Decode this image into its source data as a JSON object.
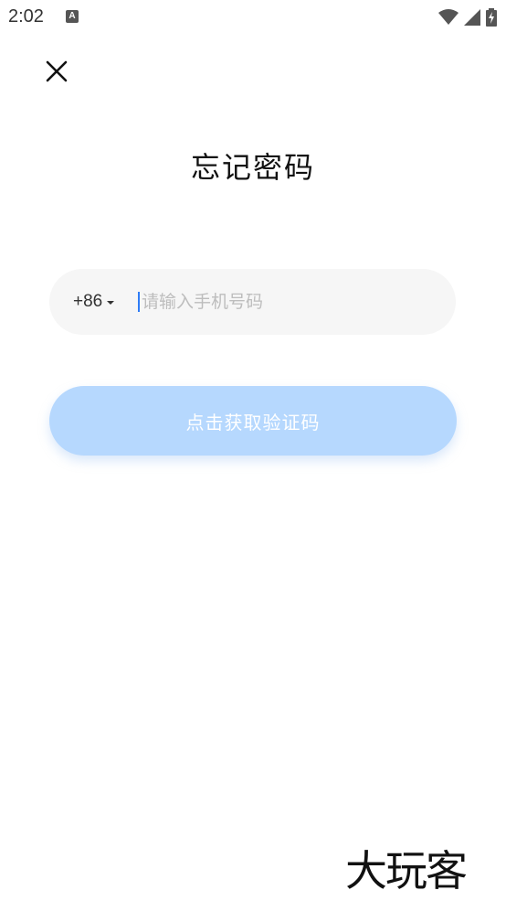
{
  "status_bar": {
    "time": "2:02",
    "notification_icon_letter": "A",
    "icons": [
      "wifi-icon",
      "signal-icon",
      "battery-charging-icon"
    ]
  },
  "close_icon": "close-icon",
  "title": "忘记密码",
  "phone_field": {
    "country_code": "+86",
    "placeholder": "请输入手机号码",
    "value": ""
  },
  "get_code_button": {
    "label": "点击获取验证码",
    "color": "#b6d8fe"
  },
  "watermark": "大玩客",
  "colors": {
    "accent_cursor": "#2f7cf6",
    "field_bg": "#f6f6f6"
  }
}
